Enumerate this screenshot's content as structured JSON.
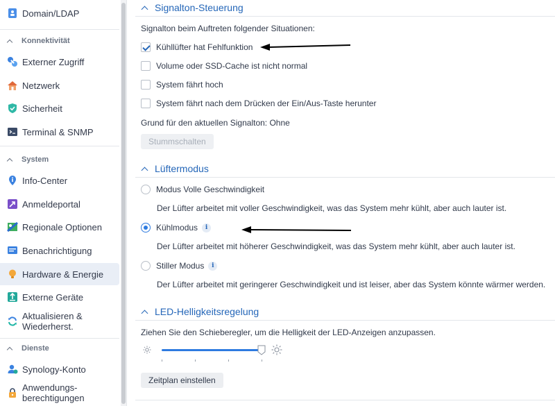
{
  "sidebar": {
    "items_top": [
      {
        "label": "Domain/LDAP",
        "icon": "domain-icon"
      }
    ],
    "group_connectivity": "Konnektivität",
    "items_connectivity": [
      {
        "label": "Externer Zugriff",
        "icon": "external-access-icon"
      },
      {
        "label": "Netzwerk",
        "icon": "network-icon"
      },
      {
        "label": "Sicherheit",
        "icon": "security-icon"
      },
      {
        "label": "Terminal & SNMP",
        "icon": "terminal-icon"
      }
    ],
    "group_system": "System",
    "items_system": [
      {
        "label": "Info-Center",
        "icon": "info-icon"
      },
      {
        "label": "Anmeldeportal",
        "icon": "login-portal-icon"
      },
      {
        "label": "Regionale Optionen",
        "icon": "regional-icon"
      },
      {
        "label": "Benachrichtigung",
        "icon": "notification-icon"
      },
      {
        "label": "Hardware & Energie",
        "icon": "hardware-icon",
        "active": true
      },
      {
        "label": "Externe Geräte",
        "icon": "external-devices-icon"
      },
      {
        "label_line1": "Aktualisieren &",
        "label_line2": "Wiederherst.",
        "icon": "update-icon"
      }
    ],
    "group_services": "Dienste",
    "items_services": [
      {
        "label": "Synology-Konto",
        "icon": "account-icon"
      },
      {
        "label_line1": "Anwendungs-",
        "label_line2": "berechtigungen",
        "icon": "permissions-icon"
      }
    ]
  },
  "beep": {
    "title": "Signalton-Steuerung",
    "intro": "Signalton beim Auftreten folgender Situationen:",
    "options": [
      {
        "label": "Kühllüfter hat Fehlfunktion",
        "checked": true
      },
      {
        "label": "Volume oder SSD-Cache ist nicht normal",
        "checked": false
      },
      {
        "label": "System fährt hoch",
        "checked": false
      },
      {
        "label": "System fährt nach dem Drücken der Ein/Aus-Taste herunter",
        "checked": false
      }
    ],
    "reason": "Grund für den aktuellen Signalton: Ohne",
    "mute_label": "Stummschalten"
  },
  "fan": {
    "title": "Lüftermodus",
    "modes": [
      {
        "label": "Modus Volle Geschwindigkeit",
        "desc": "Der Lüfter arbeitet mit voller Geschwindigkeit, was das System mehr kühlt, aber auch lauter ist.",
        "selected": false,
        "info": false
      },
      {
        "label": "Kühlmodus",
        "desc": "Der Lüfter arbeitet mit höherer Geschwindigkeit, was das System mehr kühlt, aber auch lauter ist.",
        "selected": true,
        "info": true
      },
      {
        "label": "Stiller Modus",
        "desc": "Der Lüfter arbeitet mit geringerer Geschwindigkeit und ist leiser, aber das System könnte wärmer werden.",
        "selected": false,
        "info": true
      }
    ],
    "info_glyph": "i"
  },
  "led": {
    "title": "LED-Helligkeitsregelung",
    "intro": "Ziehen Sie den Schieberegler, um die Helligkeit der LED-Anzeigen anzupassen.",
    "level_fraction": 1.0,
    "schedule_label": "Zeitplan einstellen"
  },
  "colors": {
    "accent": "#2466b8",
    "radio_selected": "#2e7be0",
    "sidebar_active": "#e9eef6"
  }
}
